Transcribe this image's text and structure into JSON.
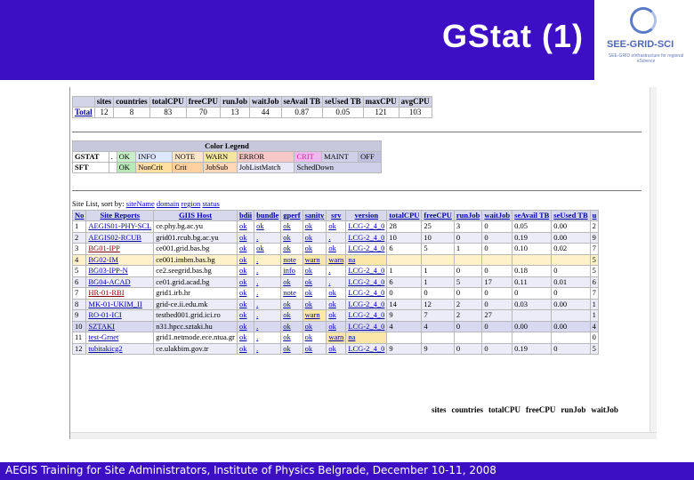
{
  "slide": {
    "title": "GStat (1)",
    "footer": "AEGIS Training for Site Administrators, Institute of Physics Belgrade, December 10-11, 2008",
    "logo_text": "SEE-GRID-SCI",
    "logo_subtext": "SEE-GRID eInfrastructure for regional eScience"
  },
  "summary": {
    "headers": [
      "",
      "sites",
      "countries",
      "totalCPU",
      "freeCPU",
      "runJob",
      "waitJob",
      "seAvail TB",
      "seUsed TB",
      "maxCPU",
      "avgCPU"
    ],
    "row": [
      "Total",
      "12",
      "8",
      "83",
      "70",
      "13",
      "44",
      "0.87",
      "0.05",
      "121",
      "103"
    ]
  },
  "legend": {
    "caption": "Color Legend",
    "row1": [
      "GSTAT",
      ".",
      "OK",
      "INFO",
      "NOTE",
      "WARN",
      "ERROR",
      "CRIT",
      "MAINT",
      "OFF"
    ],
    "row2": [
      "SFT",
      "",
      "OK",
      "NonCrit",
      "Crit",
      "JobSub",
      "JobListMatch",
      "SchedDown"
    ]
  },
  "sort_line": {
    "prefix": "Site List, sort by:",
    "links": [
      "siteName",
      "domain",
      "region",
      "status"
    ]
  },
  "sites": {
    "headers": [
      "No",
      "Site Reports",
      "GIIS Host",
      "bdii",
      "bundle",
      "gperf",
      "sanity",
      "srv",
      "version",
      "totalCPU",
      "freeCPU",
      "runJob",
      "waitJob",
      "seAvail TB",
      "seUsed TB",
      "u"
    ],
    "rows": [
      [
        "1",
        "AEGIS01-PHY-SCL",
        "ce.phy.bg.ac.yu",
        "ok",
        "ok",
        "ok",
        "ok",
        "ok",
        "LCG-2_4_0",
        "28",
        "25",
        "3",
        "0",
        "0.05",
        "0.00",
        "2"
      ],
      [
        "2",
        "AEGIS02-RCUB",
        "grid01.rcub.bg.ac.yu",
        "ok",
        ".",
        "ok",
        "ok",
        ".",
        "LCG-2_4_0",
        "10",
        "10",
        "0",
        "0",
        "0.19",
        "0.00",
        "9"
      ],
      [
        "3",
        "BG01-IPP",
        "ce001.grid.bas.bg",
        "ok",
        "ok",
        "ok",
        "ok",
        "ok",
        "LCG-2_4_0",
        "6",
        "5",
        "1",
        "0",
        "0.10",
        "0.02",
        "7"
      ],
      [
        "4",
        "BG02-IM",
        "ce001.imbm.bas.bg",
        "ok",
        ".",
        "note",
        "warn",
        "warn",
        "na",
        "",
        "",
        "",
        "",
        "",
        "",
        "5"
      ],
      [
        "5",
        "BG03-IPP-N",
        "ce2.seegrid.bas.bg",
        "ok",
        ".",
        "info",
        "ok",
        ".",
        "LCG-2_4_0",
        "1",
        "1",
        "0",
        "0",
        "0.18",
        "0",
        "5"
      ],
      [
        "6",
        "BG04-ACAD",
        "ce01.grid.acad.bg",
        "ok",
        ".",
        "ok",
        "ok",
        ".",
        "LCG-2_4_0",
        "6",
        "1",
        "5",
        "17",
        "0.11",
        "0.01",
        "6"
      ],
      [
        "7",
        "HR-01-RBI",
        "grid1.irb.hr",
        "ok",
        ".",
        "note",
        "ok",
        "ok",
        "LCG-2_4_0",
        "0",
        "0",
        "0",
        "0",
        "0",
        "0",
        "7"
      ],
      [
        "8",
        "MK-01-UKIM_II",
        "grid-ce.ii.edu.mk",
        "ok",
        ".",
        "ok",
        "ok",
        "ok",
        "LCG-2_4_0",
        "14",
        "12",
        "2",
        "0",
        "0.03",
        "0.00",
        "1"
      ],
      [
        "9",
        "RO-01-ICI",
        "testbed001.grid.ici.ro",
        "ok",
        ".",
        "ok",
        "warn",
        "ok",
        "LCG-2_4_0",
        "9",
        "7",
        "2",
        "27",
        "",
        "",
        "1"
      ],
      [
        "10",
        "SZTAKI",
        "n31.hpcc.sztaki.hu",
        "ok",
        ".",
        "ok",
        "ok",
        "ok",
        "LCG-2_4_0",
        "4",
        "4",
        "0",
        "0",
        "0.00",
        "0.00",
        "4"
      ],
      [
        "11",
        "test-Grnet",
        "grid1.netmode.ece.ntua.gr",
        "ok",
        ".",
        "ok",
        "ok",
        "warn",
        "na",
        "",
        "",
        "",
        "",
        "",
        "",
        "0"
      ],
      [
        "12",
        "tubitakicg2",
        "ce.ulakbim.gov.tr",
        "ok",
        ".",
        "ok",
        "ok",
        "ok",
        "LCG-2_4_0",
        "9",
        "9",
        "0",
        "0",
        "0.19",
        "0",
        "5"
      ]
    ],
    "footer_headers": [
      "sites",
      "countries",
      "totalCPU",
      "freeCPU",
      "runJob",
      "waitJob"
    ]
  },
  "colors": {
    "banner": "#3d0fc4",
    "ok": "#c8f0c8",
    "info": "#dde8ff",
    "note": "#ffe6c8",
    "warn": "#f6e7a0",
    "error": "#f8c8c8",
    "crit": "#f0b8f0",
    "maint": "#d0d0e8",
    "off": "#c0c0e0"
  }
}
